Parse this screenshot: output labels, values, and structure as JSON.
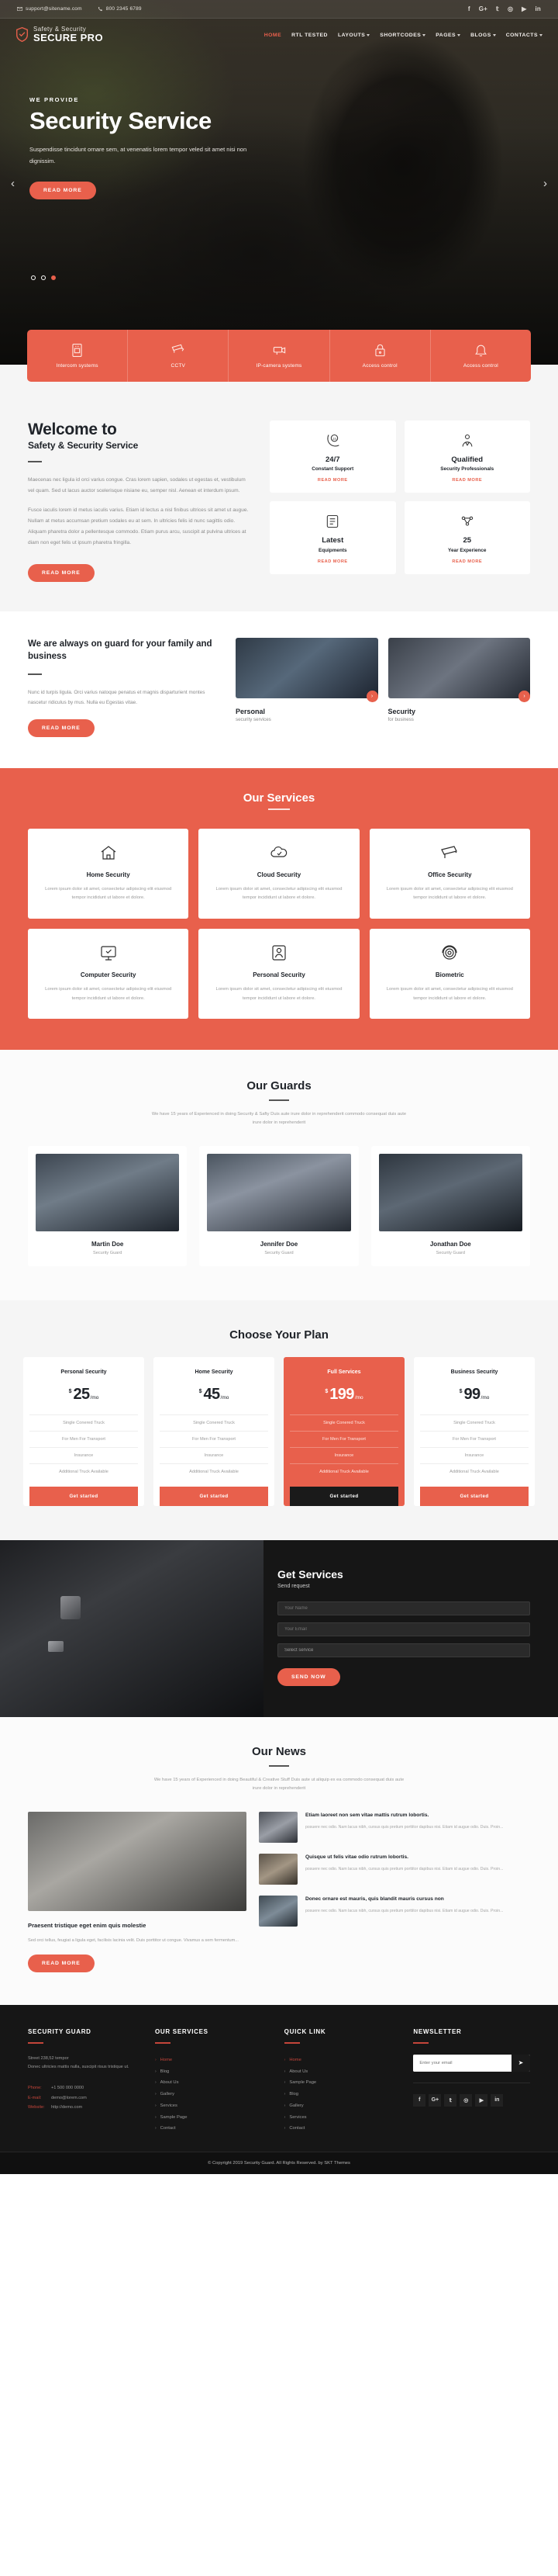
{
  "topbar": {
    "email": "support@sitename.com",
    "phone": "800 2345 6789",
    "socials": [
      "f",
      "G+",
      "𝕥",
      "◎",
      "▶",
      "in"
    ]
  },
  "brand": {
    "line1": "Safety & Security",
    "line2": "SECURE PRO"
  },
  "menu": [
    {
      "label": "HOME",
      "caret": false,
      "active": true
    },
    {
      "label": "RTL TESTED",
      "caret": false,
      "active": false
    },
    {
      "label": "LAYOUTS",
      "caret": true,
      "active": false
    },
    {
      "label": "SHORTCODES",
      "caret": true,
      "active": false
    },
    {
      "label": "PAGES",
      "caret": true,
      "active": false
    },
    {
      "label": "BLOGS",
      "caret": true,
      "active": false
    },
    {
      "label": "CONTACTS",
      "caret": true,
      "active": false
    }
  ],
  "hero": {
    "kicker": "WE PROVIDE",
    "title": "Security Service",
    "desc": "Suspendisse tincidunt ornare sem, at venenatis lorem tempor veled sit amet nisi non dignissim.",
    "cta": "READ MORE",
    "prev": "‹",
    "next": "›"
  },
  "strip": [
    {
      "label": "Intercom systems",
      "icon": "intercom-icon"
    },
    {
      "label": "CCTV",
      "icon": "cctv-icon"
    },
    {
      "label": "IP-camera systems",
      "icon": "ip-camera-icon"
    },
    {
      "label": "Access control",
      "icon": "access-control-icon"
    },
    {
      "label": "Access control",
      "icon": "alarm-icon"
    }
  ],
  "welcome": {
    "h2": "Welcome to",
    "h3": "Safety & Security Service",
    "p1": "Maecenas nec ligula id orci varius congue. Cras lorem sapien, sodales ut egestas et, vestibulum vel quam. Sed ut lacus auctor scelerisque nisiane eu, semper nisl. Aenean et interdum ipsum.",
    "p2": "Fusce iaculis lorem id metus iaculis varius. Etiam id lectus a nisl finibus ultrices sit amet ut augue. Nullam at metus accumsan pretium sodales eu at sem. In ultricies felis id nunc sagittis odio. Aliquam pharetra dolor a pellentesque commodo. Etiam purus arcu, suscipit at pulvina ultrices at diam non eget felis ut ipsum pharetra fringilla.",
    "cta": "READ MORE",
    "boxes": [
      {
        "title": "24/7",
        "sub": "Constant Support",
        "more": "READ MORE",
        "icon": "support-24-icon"
      },
      {
        "title": "Qualified",
        "sub": "Security Professionals",
        "more": "READ MORE",
        "icon": "professionals-icon"
      },
      {
        "title": "Latest",
        "sub": "Equipments",
        "more": "READ MORE",
        "icon": "equipment-icon"
      },
      {
        "title": "25",
        "sub": "Year Experience",
        "more": "READ MORE",
        "icon": "experience-icon"
      }
    ]
  },
  "guardrow": {
    "heading": "We are always on guard for your family and business",
    "text": "Nunc id turpis ligula. Orci varius natoque penatus et magnis disparturient montes nascetur ridiculus by mus. Nulla eu Egestas vitae.",
    "cta": "READ MORE",
    "cards": [
      {
        "title": "Personal",
        "sub": "security services",
        "arrow": "›"
      },
      {
        "title": "Security",
        "sub": "for business",
        "arrow": "›"
      }
    ]
  },
  "services": {
    "title": "Our Services",
    "items": [
      {
        "name": "Home Security",
        "icon": "home-security-icon",
        "text": "Lorem ipsum dolor sit amet, consectetur adipiscing elit eiusmod tempor incididunt ut labore et dolore."
      },
      {
        "name": "Cloud Security",
        "icon": "cloud-security-icon",
        "text": "Lorem ipsum dolor sit amet, consectetur adipiscing elit eiusmod tempor incididunt ut labore et dolore."
      },
      {
        "name": "Office Security",
        "icon": "office-security-icon",
        "text": "Lorem ipsum dolor sit amet, consectetur adipiscing elit eiusmod tempor incididunt ut labore et dolore."
      },
      {
        "name": "Computer Security",
        "icon": "computer-security-icon",
        "text": "Lorem ipsum dolor sit amet, consectetur adipiscing elit eiusmod tempor incididunt ut labore et dolore."
      },
      {
        "name": "Personal Security",
        "icon": "personal-security-icon",
        "text": "Lorem ipsum dolor sit amet, consectetur adipiscing elit eiusmod tempor incididunt ut labore et dolore."
      },
      {
        "name": "Biometric",
        "icon": "biometric-icon",
        "text": "Lorem ipsum dolor sit amet, consectetur adipiscing elit eiusmod tempor incididunt ut labore et dolore."
      }
    ]
  },
  "guards": {
    "title": "Our Guards",
    "sub": "We have 15 years of Experienced in doing Security & Safty Duis aute irure dolor in reprehenderit commodo consequat duis aute irure dolor in reprehenderit",
    "people": [
      {
        "name": "Martin Doe",
        "role": "Security Guard"
      },
      {
        "name": "Jennifer Doe",
        "role": "Security Guard"
      },
      {
        "name": "Jonathan Doe",
        "role": "Security Guard"
      }
    ]
  },
  "pricing": {
    "title": "Choose Your Plan",
    "plans": [
      {
        "name": "Personal Security",
        "currency": "$",
        "amount": "25",
        "period": "/mo",
        "features": [
          "Single Conered Truck",
          "For Men For Transport",
          "Insurance",
          "Additional Truck Available"
        ],
        "cta": "Get started",
        "featured": false
      },
      {
        "name": "Home Security",
        "currency": "$",
        "amount": "45",
        "period": "/mo",
        "features": [
          "Single Conered Truck",
          "For Men For Transport",
          "Insurance",
          "Additional Truck Available"
        ],
        "cta": "Get started",
        "featured": false
      },
      {
        "name": "Full Services",
        "currency": "$",
        "amount": "199",
        "period": "/mo",
        "features": [
          "Single Conered Truck",
          "For Men For Transport",
          "Insurance",
          "Additional Truck Available"
        ],
        "cta": "Get started",
        "featured": true
      },
      {
        "name": "Business Security",
        "currency": "$",
        "amount": "99",
        "period": "/mo",
        "features": [
          "Single Conered Truck",
          "For Men For Transport",
          "Insurance",
          "Additional Truck Available"
        ],
        "cta": "Get started",
        "featured": false
      }
    ]
  },
  "getservices": {
    "title": "Get Services",
    "sub": "Send request",
    "name_placeholder": "Your Name",
    "email_placeholder": "Your Email",
    "select_value": "Select service",
    "cta": "SEND NOW"
  },
  "news": {
    "title": "Our News",
    "sub": "We have 15 years of Experienced in doing Beautiful & Creative Stuff Duis aute ut aliquip ex ea commodo consequat duis aute irure dolor in reprehenderit",
    "main": {
      "title": "Praesent tristique eget enim quis molestie",
      "text": "Sed orci tellus, feugiat a ligula eget, facilisis lacinia velit. Duis porttitor ut congue. Vivamus a sem fermentum...",
      "cta": "READ MORE"
    },
    "items": [
      {
        "title": "Etiam laoreet non sem vitae mattis rutrum lobortis.",
        "text": "posuere nec odio. Nam lacus nibh, cursus quis pretium porttitor dapibus nisi. Etiam id augue odio. Duis. Proin...",
        "meta": ""
      },
      {
        "title": "Quisque ut felis vitae odio rutrum lobortis.",
        "text": "posuere nec odio. Nam lacus nibh, cursus quis pretium porttitor dapibus nisi. Etiam id augue odio. Duis. Proin...",
        "meta": ""
      },
      {
        "title": "Donec ornare est mauris, quis blandit mauris cursus non",
        "text": "posuere nec odio. Nam lacus nibh, cursus quis pretium porttitor dapibus nisi. Etiam id augue odio. Duis. Proin...",
        "meta": ""
      }
    ]
  },
  "footer": {
    "col1": {
      "heading": "SECURITY GUARD",
      "address": "Street 238,52 tempor\nDonec ultricies mattis nulla, suscipit risus tristique ut.",
      "phone_label": "Phone:",
      "phone_value": "+1 500 000 0000",
      "email_label": "E-mail:",
      "email_value": "demo@lorem.com",
      "web_label": "Website:",
      "web_value": "http://demo.com"
    },
    "col2": {
      "heading": "OUR SERVICES",
      "links": [
        "Home",
        "Blog",
        "About Us",
        "Gallery",
        "Services",
        "Sample Page",
        "Contact"
      ]
    },
    "col3": {
      "heading": "QUICK LINK",
      "links": [
        "Home",
        "About Us",
        "Sample Page",
        "Blog",
        "Gallery",
        "Services",
        "Contact"
      ]
    },
    "col4": {
      "heading": "NEWSLETTER",
      "placeholder": "Enter your email",
      "send_icon": "➤",
      "socials": [
        "f",
        "G+",
        "𝕥",
        "◎",
        "▶",
        "in"
      ]
    },
    "copyright": "© Copyright 2019 Security Guard. All Rights Reserved. by SKT Themes"
  },
  "colors": {
    "accent": "#e8604c",
    "dark": "#161616",
    "footer_accent": "#c4453a"
  }
}
